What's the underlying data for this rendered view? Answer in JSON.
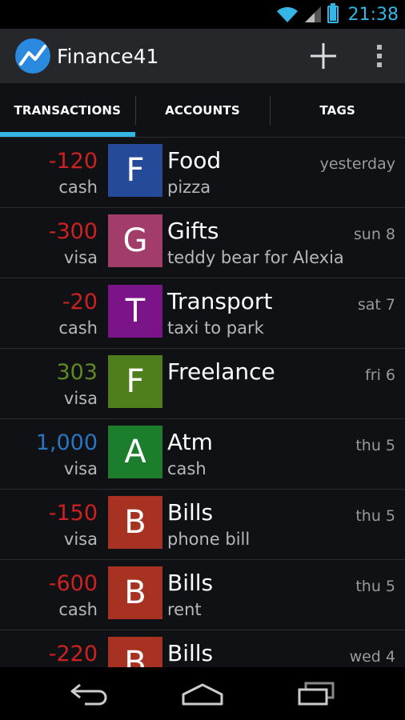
{
  "status_bar": {
    "time": "21:38"
  },
  "action_bar": {
    "title": "Finance41"
  },
  "tabs": [
    {
      "label": "TRANSACTIONS",
      "active": true
    },
    {
      "label": "ACCOUNTS",
      "active": false
    },
    {
      "label": "TAGS",
      "active": false
    }
  ],
  "transactions": [
    {
      "amount": "-120",
      "amount_color": "#cc2222",
      "account": "cash",
      "letter": "F",
      "tag_color": "#264a9a",
      "category": "Food",
      "note": "pizza",
      "date": "yesterday"
    },
    {
      "amount": "-300",
      "amount_color": "#cc2222",
      "account": "visa",
      "letter": "G",
      "tag_color": "#a23c68",
      "category": "Gifts",
      "note": "teddy bear for Alexia",
      "date": "sun 8"
    },
    {
      "amount": "-20",
      "amount_color": "#cc2222",
      "account": "cash",
      "letter": "T",
      "tag_color": "#7a1488",
      "category": "Transport",
      "note": "taxi to park",
      "date": "sat 7"
    },
    {
      "amount": "303",
      "amount_color": "#5f8a24",
      "account": "visa",
      "letter": "F",
      "tag_color": "#4f7e1c",
      "category": "Freelance",
      "note": "",
      "date": "fri 6"
    },
    {
      "amount": "1,000",
      "amount_color": "#2a74c0",
      "account": "visa",
      "letter": "A",
      "tag_color": "#1c7e2c",
      "category": "Atm",
      "note": "cash",
      "date": "thu 5"
    },
    {
      "amount": "-150",
      "amount_color": "#cc2222",
      "account": "visa",
      "letter": "B",
      "tag_color": "#a83222",
      "category": "Bills",
      "note": "phone bill",
      "date": "thu 5"
    },
    {
      "amount": "-600",
      "amount_color": "#cc2222",
      "account": "cash",
      "letter": "B",
      "tag_color": "#a83222",
      "category": "Bills",
      "note": "rent",
      "date": "thu 5"
    },
    {
      "amount": "-220",
      "amount_color": "#cc2222",
      "account": "",
      "letter": "B",
      "tag_color": "#a83222",
      "category": "Bills",
      "note": "",
      "date": "wed 4"
    }
  ],
  "icons": {
    "wifi": "wifi-icon",
    "signal": "signal-icon",
    "battery": "battery-icon",
    "logo": "app-logo-icon",
    "add": "plus-icon",
    "overflow": "overflow-menu-icon",
    "back": "back-icon",
    "home": "home-icon",
    "recents": "recents-icon"
  }
}
